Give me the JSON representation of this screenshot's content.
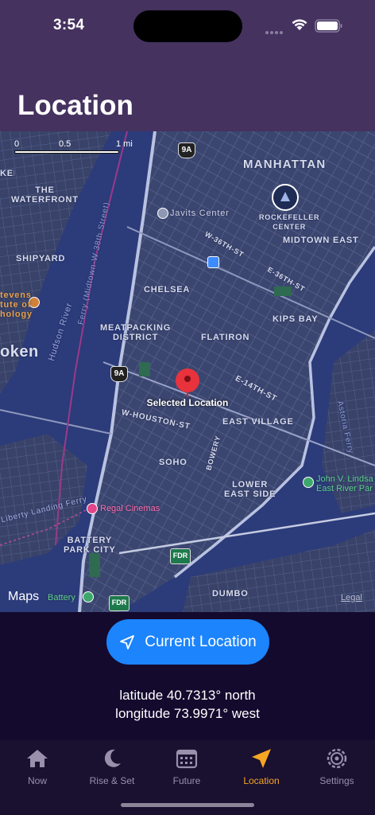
{
  "status_bar": {
    "time": "3:54"
  },
  "header": {
    "title": "Location"
  },
  "map": {
    "scale_labels": [
      "0",
      "0.5",
      "1 mi"
    ],
    "labels": {
      "manhattan": "MANHATTAN",
      "waterfront": "THE\nWATERFRONT",
      "javits": "Javits Center",
      "rockefeller": "ROCKEFELLER\nCENTER",
      "midtown_east": "MIDTOWN EAST",
      "shipyard": "SHIPYARD",
      "w36": "W-36TH-ST",
      "e36": "E-36TH-ST",
      "chelsea": "CHELSEA",
      "kips_bay": "KIPS BAY",
      "stevens": "tevens\ntute of\nhology",
      "hudson": "Hudson River",
      "meatpacking": "MEATPACKING\nDISTRICT",
      "flatiron": "FLATIRON",
      "hoboken": "oken",
      "e14": "E-14TH-ST",
      "houston": "W-HOUSTON-ST",
      "east_village": "EAST VILLAGE",
      "astoria_ferry": "Astoria Ferry",
      "soho": "SOHO",
      "bowery": "BOWERY",
      "lower_east_side": "LOWER\nEAST SIDE",
      "lindsay": "John V. Lindsa\nEast River Par",
      "regal": "Regal Cinemas",
      "liberty_ferry": "Liberty Landing Ferry",
      "battery_park": "BATTERY\nPARK CITY",
      "battery": "Battery",
      "dumbo": "DUMBO",
      "fdr1": "FDR",
      "fdr2": "FDR",
      "route_9a_top": "9A",
      "route_9a_mid": "9A",
      "ferry_38th": "Ferry (Midtown-W 38th Street)"
    },
    "pin_label": "Selected Location",
    "maps_brand": "Maps",
    "legal": "Legal"
  },
  "actions": {
    "current_location_label": "Current Location"
  },
  "coordinates": {
    "latitude": "latitude 40.7313° north",
    "longitude": "longitude 73.9971° west"
  },
  "tabs": [
    {
      "label": "Now",
      "icon": "house-icon"
    },
    {
      "label": "Rise & Set",
      "icon": "moon-icon"
    },
    {
      "label": "Future",
      "icon": "calendar-icon"
    },
    {
      "label": "Location",
      "icon": "location-arrow-icon",
      "active": true
    },
    {
      "label": "Settings",
      "icon": "gear-icon"
    }
  ],
  "colors": {
    "header_bg": "#45325f",
    "page_bg": "#140a2e",
    "accent_button": "#1c84fc",
    "active_tab": "#f5a623",
    "inactive_tab": "#9a90ac",
    "map_water": "#2c3b7a",
    "map_land": "#3a4466",
    "pin_red": "#e8323c"
  }
}
